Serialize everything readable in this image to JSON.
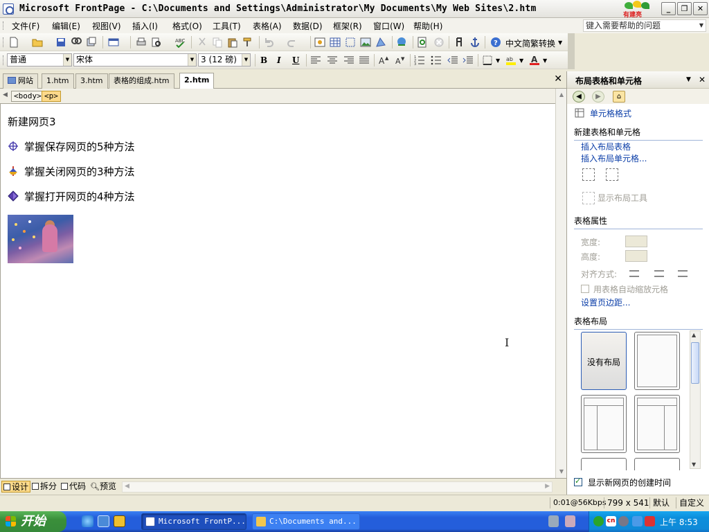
{
  "window": {
    "title": "Microsoft FrontPage - C:\\Documents and Settings\\Administrator\\My Documents\\My Web Sites\\2.htm",
    "brand_text": "有建亮"
  },
  "menubar": {
    "items": [
      "文件(F)",
      "编辑(E)",
      "视图(V)",
      "插入(I)",
      "格式(O)",
      "工具(T)",
      "表格(A)",
      "数据(D)",
      "框架(R)",
      "窗口(W)",
      "帮助(H)"
    ],
    "help_placeholder": "键入需要帮助的问题"
  },
  "toolbar_standard": {
    "convert_label": "中文简繁转换"
  },
  "toolbar_format": {
    "style": "普通",
    "font": "宋体",
    "size": "3 (12 磅)",
    "bold": "B",
    "italic": "I",
    "underline": "U"
  },
  "tabs": [
    {
      "label": "网站"
    },
    {
      "label": "1.htm"
    },
    {
      "label": "3.htm"
    },
    {
      "label": "表格的组成.htm"
    },
    {
      "label": "2.htm"
    }
  ],
  "tags": [
    "<body>",
    "<p>"
  ],
  "document": {
    "heading": "新建网页3",
    "items": [
      "掌握保存网页的5种方法",
      "掌握关闭网页的3种方法",
      "掌握打开网页的4种方法"
    ]
  },
  "views": [
    "设计",
    "拆分",
    "代码",
    "预览"
  ],
  "taskpane": {
    "title": "布局表格和单元格",
    "cell_format": "单元格格式",
    "section_new": "新建表格和单元格",
    "insert_table": "插入布局表格",
    "insert_cell": "插入布局单元格...",
    "show_tool": "显示布局工具",
    "section_props": "表格属性",
    "width_label": "宽度:",
    "height_label": "高度:",
    "align_label": "对齐方式:",
    "autoscale_label": "用表格自动缩放元格",
    "margins_link": "设置页边距...",
    "section_layout": "表格布局",
    "no_layout": "没有布局",
    "show_time": "显示新网页的创建时间"
  },
  "statusbar": {
    "speed": "0:01@56Kbps",
    "size": "799 x 541",
    "default": "默认",
    "custom": "自定义"
  },
  "taskbar": {
    "start": "开始",
    "buttons": [
      "Microsoft FrontP...",
      "C:\\Documents and..."
    ],
    "time": "上午 8:53",
    "ime": "cn"
  }
}
